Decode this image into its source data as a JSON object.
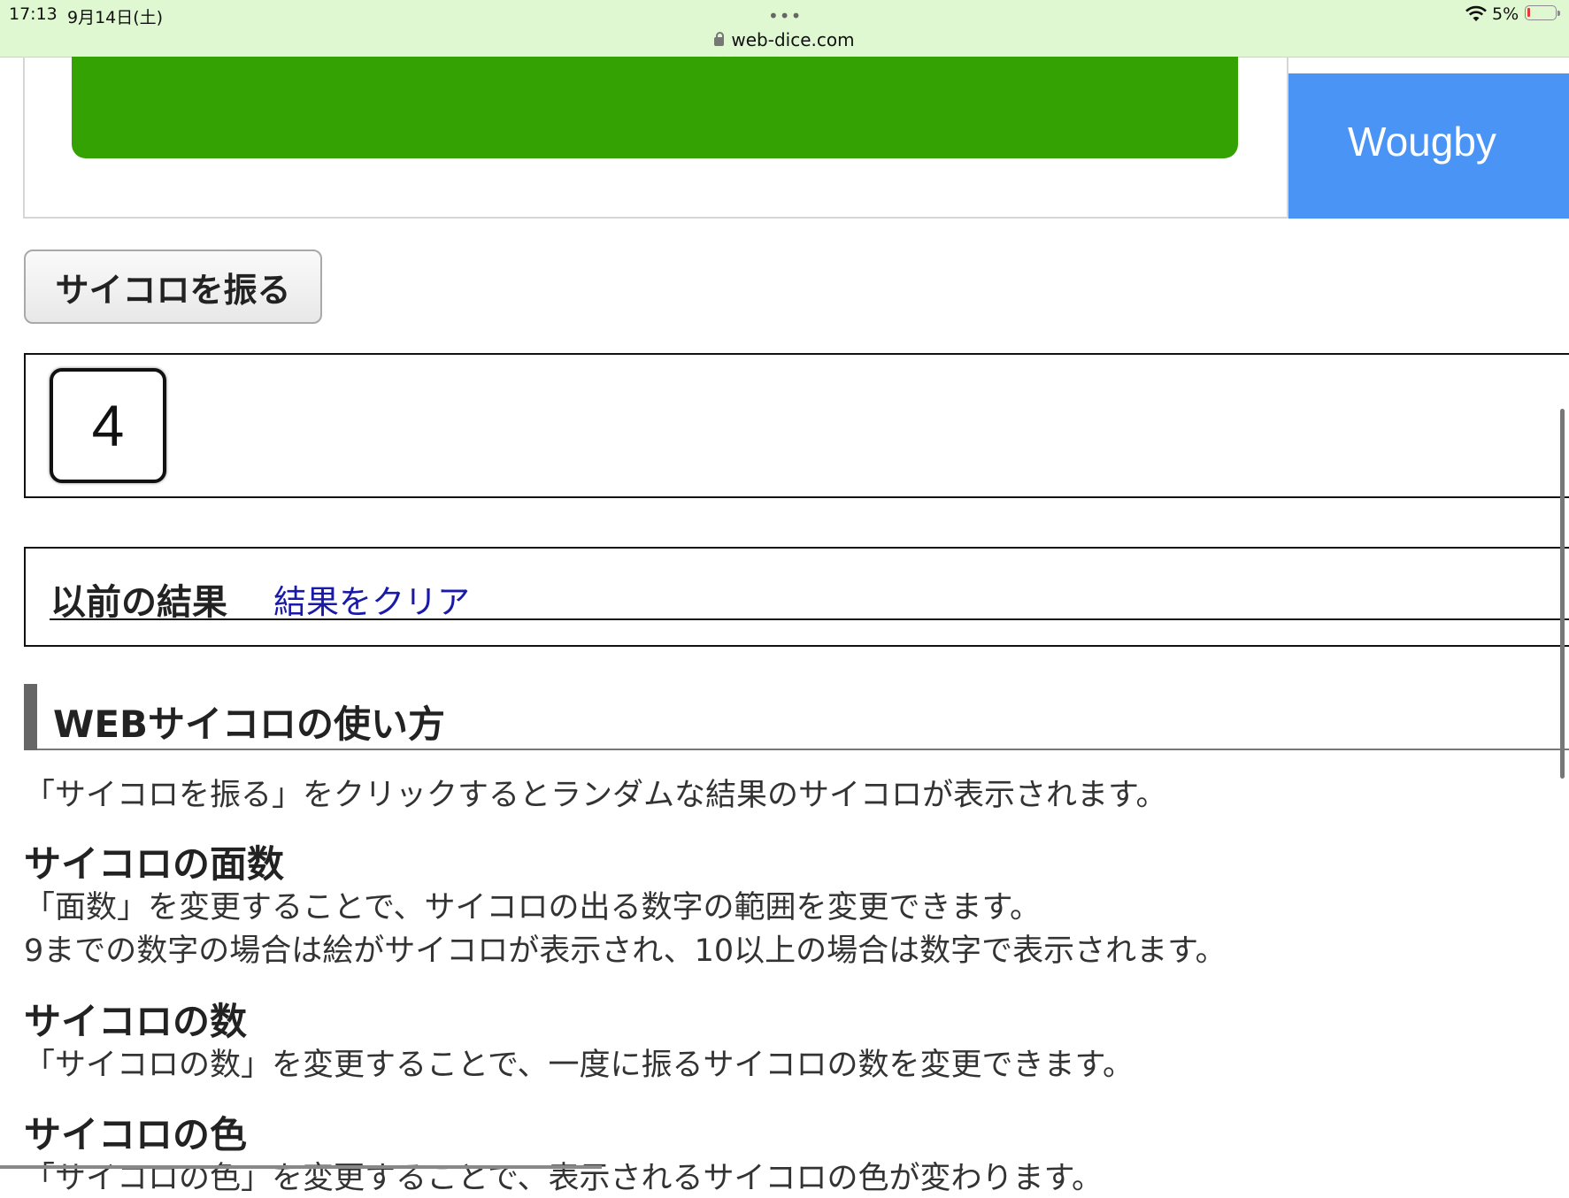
{
  "status_bar": {
    "time": "17:13",
    "date": "9月14日(土)",
    "dots": "•••",
    "url": "web-dice.com",
    "battery": "5%"
  },
  "ad": {
    "blue_text": "Wougby"
  },
  "controls": {
    "roll_button": "サイコロを振る"
  },
  "result": {
    "dice": [
      "4"
    ]
  },
  "history": {
    "title": "以前の結果",
    "clear_link": "結果をクリア"
  },
  "howto": {
    "heading": "WEBサイコロの使い方",
    "intro": "「サイコロを振る」をクリックするとランダムな結果のサイコロが表示されます。",
    "faces_title": "サイコロの面数",
    "faces_text1": "「面数」を変更することで、サイコロの出る数字の範囲を変更できます。",
    "faces_text2": "9までの数字の場合は絵がサイコロが表示され、10以上の場合は数字で表示されます。",
    "count_title": "サイコロの数",
    "count_text": "「サイコロの数」を変更することで、一度に振るサイコロの数を変更できます。",
    "color_title": "サイコロの色",
    "color_text": "「サイコロの色」を変更することで、表示されるサイコロの色が変わります。"
  },
  "colors": {
    "status_bar_bg": "#dff8d2",
    "ad_green": "#34a203",
    "ad_blue": "#4a94f5",
    "link": "#1a1aa8"
  }
}
